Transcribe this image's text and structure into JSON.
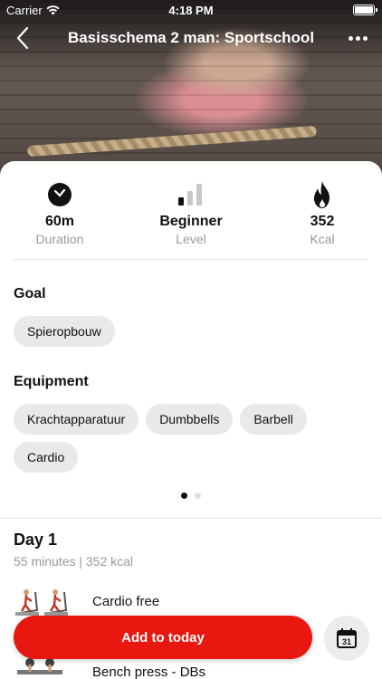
{
  "status_bar": {
    "carrier": "Carrier",
    "time": "4:18 PM"
  },
  "nav": {
    "title": "Basisschema 2 man: Sportschool"
  },
  "stats": [
    {
      "value": "60m",
      "label": "Duration",
      "icon": "clock-icon"
    },
    {
      "value": "Beginner",
      "label": "Level",
      "icon": "level-bars-icon"
    },
    {
      "value": "352",
      "label": "Kcal",
      "icon": "flame-icon"
    }
  ],
  "goal": {
    "title": "Goal",
    "chips": [
      "Spieropbouw"
    ]
  },
  "equipment": {
    "title": "Equipment",
    "chips": [
      "Krachtapparatuur",
      "Dumbbells",
      "Barbell",
      "Cardio"
    ]
  },
  "pager": {
    "pages": 2,
    "active": 0
  },
  "day": {
    "title": "Day 1",
    "subtitle": "55 minutes | 352 kcal",
    "exercises": [
      {
        "name": "Cardio free"
      },
      {
        "name": "Bench press - DBs"
      }
    ]
  },
  "actions": {
    "add_label": "Add to today",
    "calendar_day": "31"
  },
  "colors": {
    "accent": "#e8170f",
    "chip_bg": "#e9e9e9",
    "muted_text": "#999999"
  }
}
